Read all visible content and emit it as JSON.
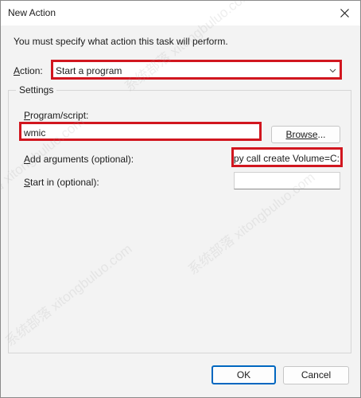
{
  "window": {
    "title": "New Action"
  },
  "instruction": "You must specify what action this task will perform.",
  "action": {
    "label_prefix": "A",
    "label_rest": "ction:",
    "selected": "Start a program"
  },
  "settings": {
    "legend": "Settings",
    "program": {
      "label_prefix": "P",
      "label_rest": "rogram/script:",
      "value": "wmic"
    },
    "browse": {
      "label_prefix": "Browse",
      "label_rest": "..."
    },
    "arguments": {
      "label_prefix": "A",
      "label_rest": "dd arguments (optional):",
      "value": "py call create Volume=C:"
    },
    "start_in": {
      "label_prefix": "S",
      "label_rest": "tart in (optional):",
      "value": ""
    }
  },
  "footer": {
    "ok": "OK",
    "cancel": "Cancel"
  },
  "watermark": "系统部落 xitongbuluo.com",
  "colors": {
    "highlight": "#d1161f",
    "accent": "#0067c0"
  }
}
